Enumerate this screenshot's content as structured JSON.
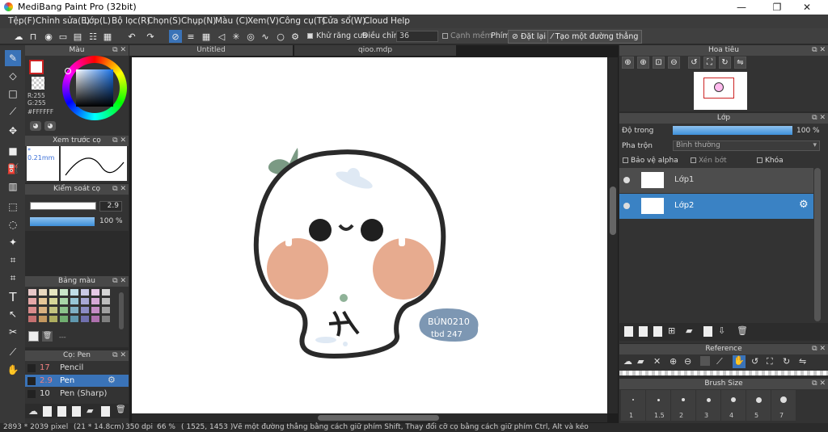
{
  "window": {
    "title": "MediBang Paint Pro (32bit)",
    "minimize": "—",
    "maximize": "❐",
    "close": "✕"
  },
  "menu": [
    "Tệp(F)",
    "Chỉnh sửa(E)",
    "Lớp(L)",
    "Bộ lọc(R)",
    "Chọn(S)",
    "Chụp(N)",
    "Màu (C)",
    "Xem(V)",
    "Công cụ(T)",
    "Cửa sổ(W)",
    "Cloud",
    "Help"
  ],
  "toolbar": {
    "antialias": "Khử răng cưa",
    "correction_label": "Điều chỉnh",
    "correction_value": "36",
    "snap": "Cạnh mềm",
    "key_label": "Phím",
    "reset": "Đặt lại",
    "straight": "Tạo một đường thẳng"
  },
  "color_panel": {
    "title": "Màu",
    "r": "R:255",
    "g": "G:255",
    "hex": "#FFFFFF",
    "primary": "#ffffff",
    "secondary_border": "#cc2222"
  },
  "brush_preview": {
    "title": "Xem trước cọ",
    "size": "* 0.21mm"
  },
  "brush_control": {
    "title": "Kiểm soát cọ",
    "size": "2.9",
    "opacity": "100 %"
  },
  "palette": {
    "title": "Bảng màu",
    "dash": "---",
    "colors": [
      "#e8c9c9",
      "#e8d8c0",
      "#e6e6c0",
      "#c9e6c9",
      "#c0dde6",
      "#c9c9e6",
      "#e6c9e6",
      "#d6d6d6",
      "#e6a8a8",
      "#e6c698",
      "#d6d698",
      "#a8d6a8",
      "#98c6d6",
      "#a8a8d6",
      "#d6a8d6",
      "#bdbdbd",
      "#d98c8c",
      "#d9b080",
      "#c4c480",
      "#8cc48c",
      "#80b0c4",
      "#8c8cc4",
      "#c48cc4",
      "#a0a0a0",
      "#c47070",
      "#c49860",
      "#aeae60",
      "#70ae70",
      "#6098ae",
      "#7070ae",
      "#ae70ae",
      "#808080"
    ]
  },
  "brush_list": {
    "title": "Cọ: Pen",
    "items": [
      {
        "size": "17",
        "name": "Pencil"
      },
      {
        "size": "2.9",
        "name": "Pen"
      },
      {
        "size": "10",
        "name": "Pen (Sharp)"
      }
    ]
  },
  "tabs": {
    "untitled": "Untitled",
    "file": "qioo.mdp"
  },
  "artwork": {
    "stamp_line1": "BÚN0210",
    "stamp_line2": "tbd 247"
  },
  "navigator": {
    "title": "Hoa tiêu"
  },
  "layers": {
    "title": "Lớp",
    "opacity_label": "Độ trong",
    "opacity_value": "100 %",
    "blend_label": "Pha trộn",
    "blend_value": "Bình thường",
    "protect": "Bảo vệ alpha",
    "clip": "Xén bớt",
    "lock": "Khóa",
    "items": [
      {
        "name": "Lớp1"
      },
      {
        "name": "Lớp2"
      }
    ]
  },
  "reference": {
    "title": "Reference"
  },
  "brush_size": {
    "title": "Brush Size",
    "sizes": [
      "1",
      "1.5",
      "2",
      "3",
      "4",
      "5",
      "7"
    ]
  },
  "status": {
    "dims": "2893 * 2039 pixel",
    "cm": "(21 * 14.8cm)",
    "dpi": "350 dpi",
    "zoom": "66 %",
    "coords": "( 1525, 1453 )",
    "hint": "Vẽ một đường thẳng bằng cách giữ phím Shift, Thay đổi cỡ cọ bằng cách giữ phím Ctrl, Alt và kéo"
  }
}
